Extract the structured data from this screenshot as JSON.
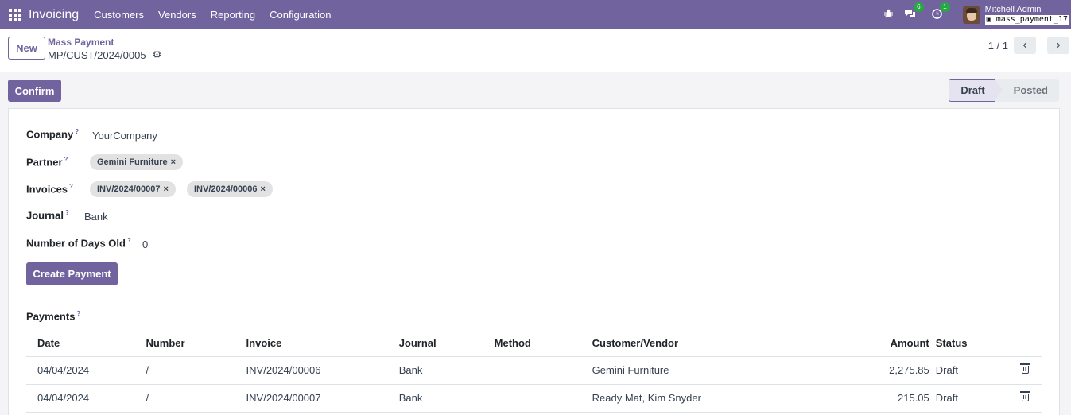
{
  "navbar": {
    "app_name": "Invoicing",
    "menu": [
      "Customers",
      "Vendors",
      "Reporting",
      "Configuration"
    ],
    "messages_count": "6",
    "activities_count": "1",
    "user_name": "Mitchell Admin",
    "database": "mass_payment_17",
    "icons": [
      "apps-grid-icon",
      "bug-icon",
      "chat-icon",
      "clock-icon",
      "database-icon"
    ]
  },
  "control_panel": {
    "new_label": "New",
    "breadcrumb_parent": "Mass Payment",
    "breadcrumb_current": "MP/CUST/2024/0005",
    "pager_value": "1 / 1"
  },
  "actions": {
    "confirm_label": "Confirm",
    "create_payment_label": "Create Payment"
  },
  "status": {
    "stages": [
      "Draft",
      "Posted"
    ],
    "active": "Draft"
  },
  "form": {
    "company_label": "Company",
    "company_value": "YourCompany",
    "partner_label": "Partner",
    "partner_tag": "Gemini Furniture",
    "invoices_label": "Invoices",
    "invoice_tags": [
      "INV/2024/00007",
      "INV/2024/00006"
    ],
    "journal_label": "Journal",
    "journal_value": "Bank",
    "days_label": "Number of Days Old",
    "days_value": "0",
    "help_mark": "?",
    "payments_label": "Payments"
  },
  "payments": {
    "columns": [
      "Date",
      "Number",
      "Invoice",
      "Journal",
      "Method",
      "Customer/Vendor",
      "Amount",
      "Status"
    ],
    "rows": [
      {
        "date": "04/04/2024",
        "number": "/",
        "invoice": "INV/2024/00006",
        "journal": "Bank",
        "method": "",
        "partner": "Gemini Furniture",
        "amount": "2,275.85",
        "status": "Draft"
      },
      {
        "date": "04/04/2024",
        "number": "/",
        "invoice": "INV/2024/00007",
        "journal": "Bank",
        "method": "",
        "partner": "Ready Mat, Kim Snyder",
        "amount": "215.05",
        "status": "Draft"
      }
    ]
  },
  "colors": {
    "brand": "#71639e",
    "badge": "#28a745",
    "tag_bg": "#e2e2e2"
  }
}
